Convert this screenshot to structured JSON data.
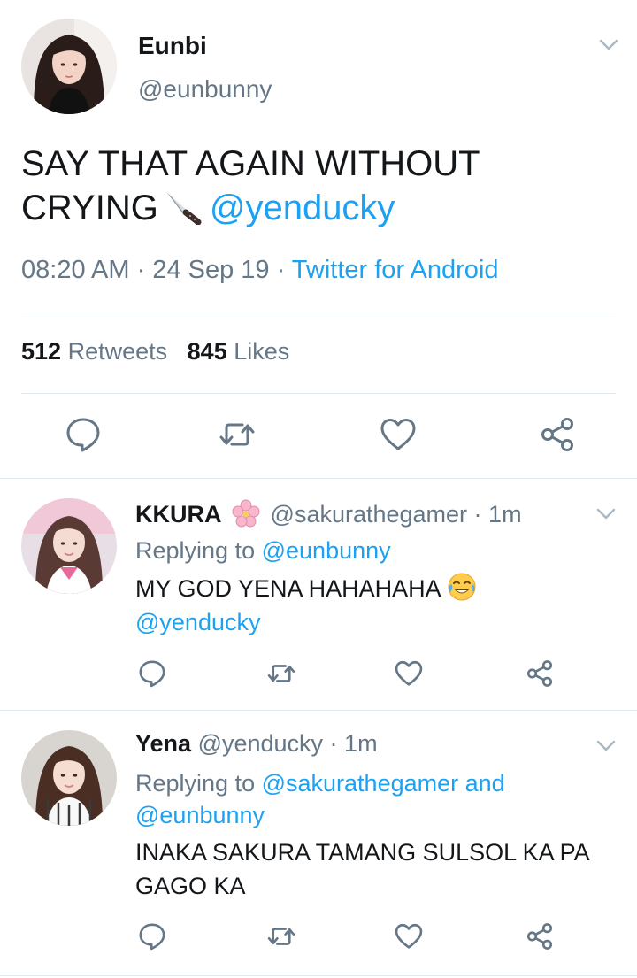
{
  "main_tweet": {
    "name": "Eunbi",
    "handle": "@eunbunny",
    "text_line1": "SAY THAT AGAIN WITHOUT",
    "text_line2": "CRYING",
    "text_emoji": "knife-icon",
    "text_mention": "@yenducky",
    "time": "08:20 AM",
    "date": "24 Sep 19",
    "separator": " · ",
    "source": "Twitter for Android",
    "retweets_count": "512",
    "retweets_label": "Retweets",
    "likes_count": "845",
    "likes_label": "Likes"
  },
  "replies": [
    {
      "name": "KKURA",
      "name_emoji": "cherry-blossom-icon",
      "handle": "@sakurathegamer",
      "time": "1m",
      "replying_prefix": "Replying to",
      "replying_to": "@eunbunny",
      "text_line1": "MY GOD YENA HAHAHAHA",
      "text_emoji": "tears-of-joy-icon",
      "text_mention": "@yenducky"
    },
    {
      "name": "Yena",
      "handle": "@yenducky",
      "time": "1m",
      "replying_prefix": "Replying to",
      "replying_to_1": "@sakurathegamer",
      "replying_and": "and",
      "replying_to_2": "@eunbunny",
      "text_line1": "INAKA SAKURA TAMANG SULSOL KA PA",
      "text_line2": "GAGO KA"
    }
  ],
  "colors": {
    "accent": "#1da1f2",
    "secondary_text": "#657786",
    "primary_text": "#14171a",
    "divider": "#e1e8ed"
  }
}
